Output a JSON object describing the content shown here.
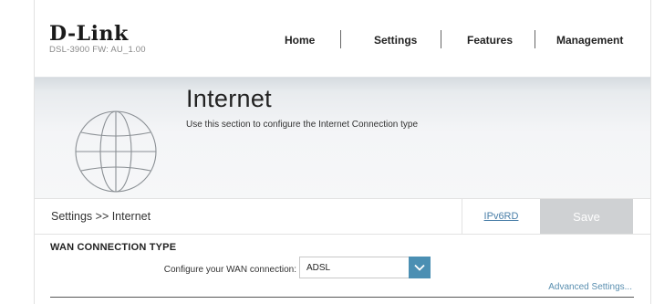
{
  "brand": {
    "logo_text": "D-Link",
    "model_firmware": "DSL-3900   FW: AU_1.00"
  },
  "nav": {
    "items": [
      "Home",
      "Settings",
      "Features",
      "Management"
    ]
  },
  "hero": {
    "title": "Internet",
    "description": "Use this section to configure the Internet Connection type"
  },
  "toolbar": {
    "breadcrumb": "Settings >> Internet",
    "ipv6rd_link": "IPv6RD",
    "save_label": "Save"
  },
  "wan": {
    "section_title": "WAN CONNECTION TYPE",
    "field_label": "Configure your WAN connection:",
    "selected_value": "ADSL",
    "advanced_link": "Advanced Settings..."
  },
  "colors": {
    "accent": "#4b8fb3",
    "link": "#4a7fa8",
    "save_disabled_bg": "#cfd1d3"
  },
  "icons": {
    "hero_icon": "globe-icon",
    "dropdown_icon": "chevron-down-icon"
  }
}
